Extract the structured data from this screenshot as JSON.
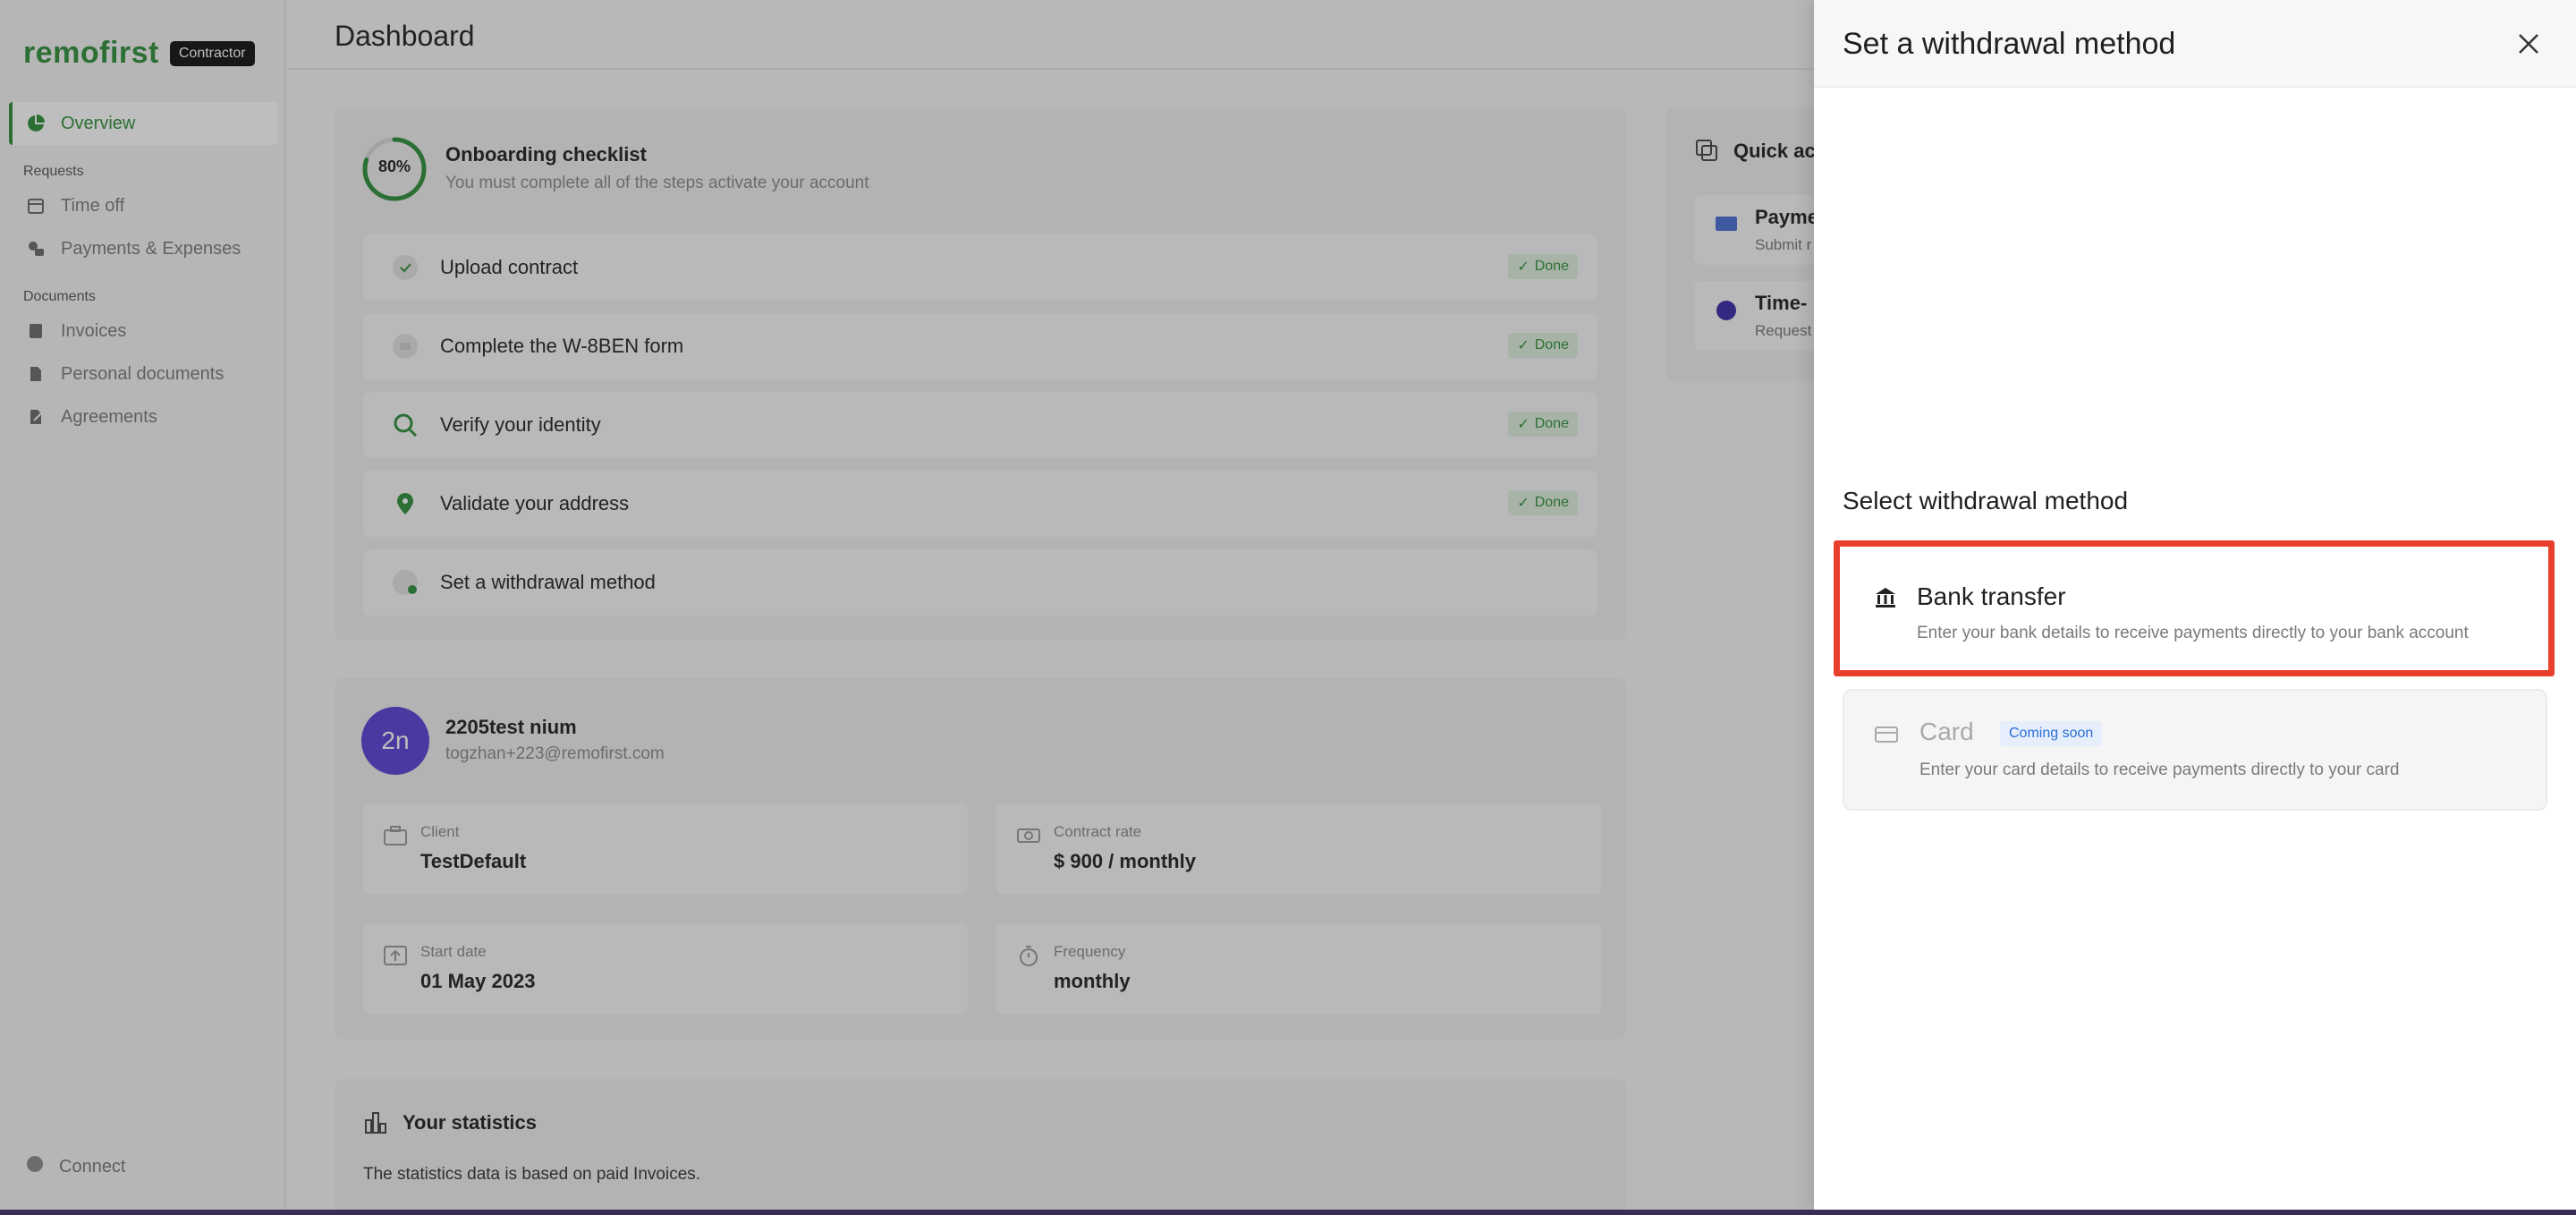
{
  "sidebar": {
    "brand": "remofirst",
    "badge": "Contractor",
    "items": [
      {
        "label": "Overview"
      },
      {
        "section": "Requests"
      },
      {
        "label": "Time off"
      },
      {
        "label": "Payments & Expenses"
      },
      {
        "section": "Documents"
      },
      {
        "label": "Invoices"
      },
      {
        "label": "Personal documents"
      },
      {
        "label": "Agreements"
      }
    ],
    "connect": "Connect"
  },
  "main": {
    "title": "Dashboard",
    "checklist": {
      "progress_label": "80%",
      "progress_value": 0.8,
      "title": "Onboarding checklist",
      "subtitle": "You must complete all of the steps activate your account",
      "steps": [
        {
          "label": "Upload contract",
          "status": "Done"
        },
        {
          "label": "Complete the W-8BEN form",
          "status": "Done"
        },
        {
          "label": "Verify your identity",
          "status": "Done"
        },
        {
          "label": "Validate your address",
          "status": "Done"
        },
        {
          "label": "Set a withdrawal method",
          "status": ""
        }
      ]
    },
    "profile": {
      "avatar": "2n",
      "name": "2205test nium",
      "email": "togzhan+223@remofirst.com",
      "client_label": "Client",
      "client_value": "TestDefault",
      "rate_label": "Contract rate",
      "rate_value": "$ 900 / monthly",
      "start_label": "Start date",
      "start_value": "01 May 2023",
      "freq_label": "Frequency",
      "freq_value": "monthly"
    },
    "stats": {
      "title": "Your statistics",
      "note": "The statistics data is based on paid Invoices."
    },
    "quick": {
      "title": "Quick ac",
      "items": [
        {
          "title": "Payme",
          "sub": "Submit r"
        },
        {
          "title": "Time-",
          "sub": "Request"
        }
      ]
    }
  },
  "drawer": {
    "title": "Set a withdrawal method",
    "section": "Select withdrawal method",
    "bank": {
      "title": "Bank transfer",
      "desc": "Enter your bank details to receive payments directly to your bank account"
    },
    "card": {
      "title": "Card",
      "badge": "Coming soon",
      "desc": "Enter your card details to receive payments directly to your card"
    }
  },
  "colors": {
    "brand": "#2f8f3a",
    "highlight": "#e8402c",
    "avatar": "#5b3fd6",
    "badge_blue": "#2b6fd6"
  }
}
